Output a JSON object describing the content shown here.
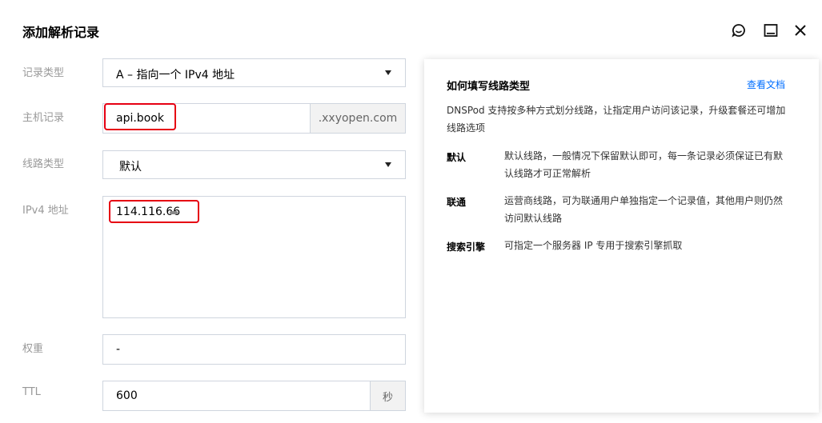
{
  "dialog": {
    "title": "添加解析记录"
  },
  "form": {
    "record_type": {
      "label": "记录类型",
      "value": "A – 指向一个 IPv4 地址"
    },
    "host": {
      "label": "主机记录",
      "value": "api.book",
      "suffix": ".xxyopen.com"
    },
    "line_type": {
      "label": "线路类型",
      "value": "默认"
    },
    "ipv4": {
      "label": "IPv4 地址",
      "value": "114.116.66"
    },
    "weight": {
      "label": "权重",
      "value": "-"
    },
    "ttl": {
      "label": "TTL",
      "value": "600",
      "unit": "秒"
    }
  },
  "help": {
    "title": "如何填写线路类型",
    "link": "查看文档",
    "description": "DNSPod 支持按多种方式划分线路，让指定用户访问该记录，升级套餐还可增加线路选项",
    "items": [
      {
        "term": "默认",
        "definition": "默认线路，一般情况下保留默认即可，每一条记录必须保证已有默认线路才可正常解析"
      },
      {
        "term": "联通",
        "definition": "运营商线路，可为联通用户单独指定一个记录值，其他用户则仍然访问默认线路"
      },
      {
        "term": "搜索引擎",
        "definition": "可指定一个服务器 IP 专用于搜索引擎抓取"
      }
    ]
  },
  "icons": {
    "feedback": "feedback-icon",
    "maximize": "maximize-icon",
    "close": "close-icon"
  },
  "colors": {
    "highlight": "#e60012",
    "link": "#006eff",
    "label": "#999999",
    "border": "#cfd5de"
  }
}
